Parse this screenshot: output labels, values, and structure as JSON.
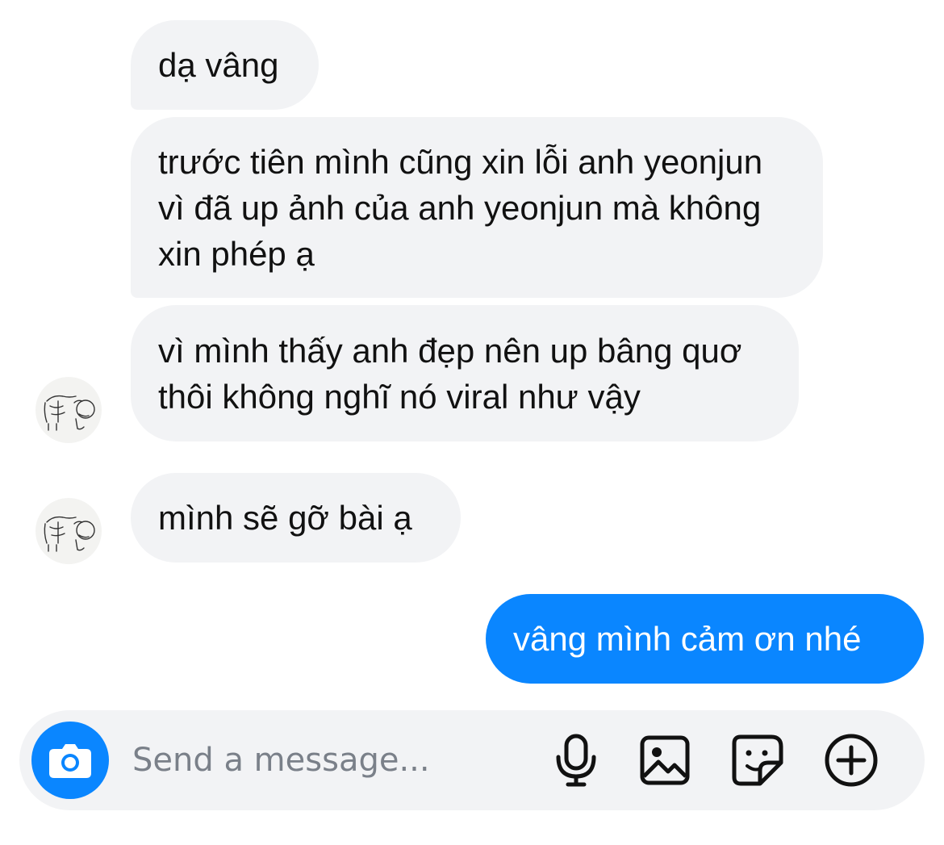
{
  "conversation": {
    "messages": [
      {
        "sender": "other",
        "lines": [
          "dạ vâng"
        ]
      },
      {
        "sender": "other",
        "lines": [
          "trước tiên mình cũng xin lỗi anh yeonjun",
          "vì đã up ảnh của anh yeonjun mà không",
          "xin phép ạ"
        ]
      },
      {
        "sender": "other",
        "lines": [
          "vì mình thấy anh đẹp nên up bâng quơ",
          "thôi không nghĩ nó viral như vậy"
        ]
      },
      {
        "sender": "other",
        "lines": [
          "mình sẽ gỡ bài ạ"
        ]
      },
      {
        "sender": "me",
        "lines": [
          "vâng mình cảm ơn nhé"
        ]
      }
    ]
  },
  "composer": {
    "placeholder": "Send a message...",
    "value": "",
    "icons": {
      "camera": "camera-icon",
      "mic": "microphone-icon",
      "gallery": "image-icon",
      "sticker": "sticker-icon",
      "add": "plus-circle-icon"
    }
  },
  "colors": {
    "accent": "#0a86ff",
    "incoming_bubble": "#f2f3f5",
    "composer_bg": "#f2f3f5",
    "placeholder": "#7a8089"
  }
}
